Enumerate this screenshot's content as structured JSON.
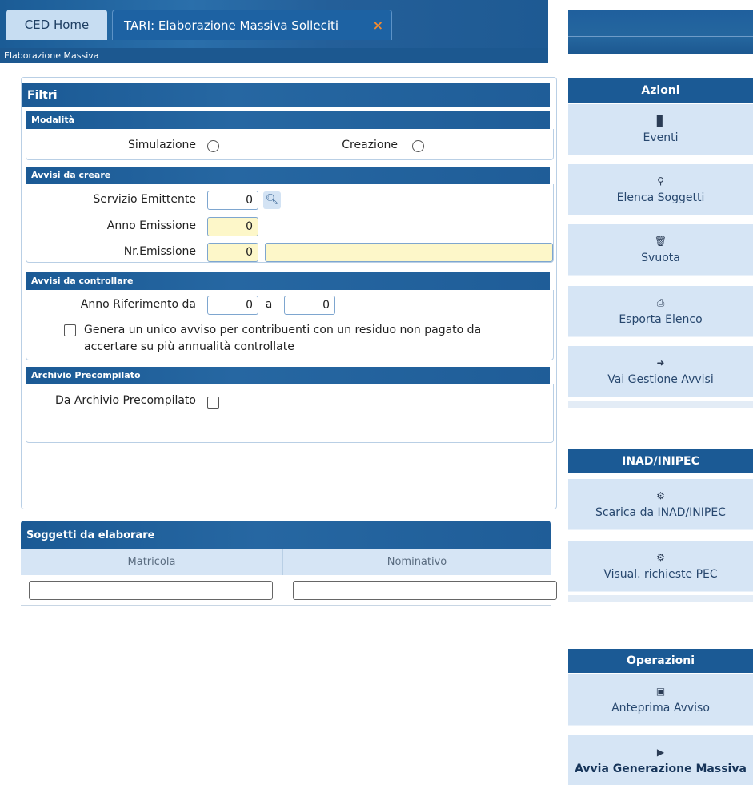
{
  "tabs": {
    "home": "CED Home",
    "active": "TARI: Elaborazione Massiva Solleciti",
    "close_glyph": "×"
  },
  "subtitle": "Elaborazione Massiva",
  "filtri": {
    "title": "Filtri",
    "modalita": {
      "title": "Modalità",
      "simulazione": "Simulazione",
      "creazione": "Creazione"
    },
    "avvisi_creare": {
      "title": "Avvisi da creare",
      "servizio_label": "Servizio Emittente",
      "servizio_value": "0",
      "anno_label": "Anno Emissione",
      "anno_value": "0",
      "nr_label": "Nr.Emissione",
      "nr_value": "0",
      "nr_desc": ""
    },
    "avvisi_controllare": {
      "title": "Avvisi da controllare",
      "anno_rif_label": "Anno Riferimento da",
      "anno_rif_from": "0",
      "a_label": "a",
      "anno_rif_to": "0",
      "genera_line1": "Genera un unico avviso per contribuenti con un residuo non pagato da",
      "genera_line2": "accertare su più annualità controllate"
    },
    "archivio": {
      "title": "Archivio Precompilato",
      "label": "Da Archivio Precompilato"
    }
  },
  "soggetti": {
    "title": "Soggetti da elaborare",
    "columns": [
      "Matricola",
      "Nominativo"
    ]
  },
  "azioni": {
    "title": "Azioni",
    "buttons": [
      {
        "label": "Eventi",
        "icon": "book-icon"
      },
      {
        "label": "Elenca Soggetti",
        "icon": "search-icon"
      },
      {
        "label": "Svuota",
        "icon": "trash-icon"
      },
      {
        "label": "Esporta Elenco",
        "icon": "print-icon"
      },
      {
        "label": "Vai Gestione Avvisi",
        "icon": "arrow-right-icon"
      }
    ]
  },
  "inad": {
    "title": "INAD/INIPEC",
    "buttons": [
      {
        "label": "Scarica da INAD/INIPEC",
        "icon": "gear-icon"
      },
      {
        "label": "Visual. richieste PEC",
        "icon": "gear-icon"
      }
    ]
  },
  "operazioni": {
    "title": "Operazioni",
    "buttons": [
      {
        "label": "Anteprima Avviso",
        "icon": "image-icon"
      },
      {
        "label": "Avvia Generazione Massiva",
        "icon": "play-icon"
      }
    ]
  },
  "colors": {
    "header_blue": "#1b5a95",
    "button_blue": "#d6e5f5",
    "yellow_field": "#fdf7c9",
    "close_orange": "#f08a32"
  }
}
